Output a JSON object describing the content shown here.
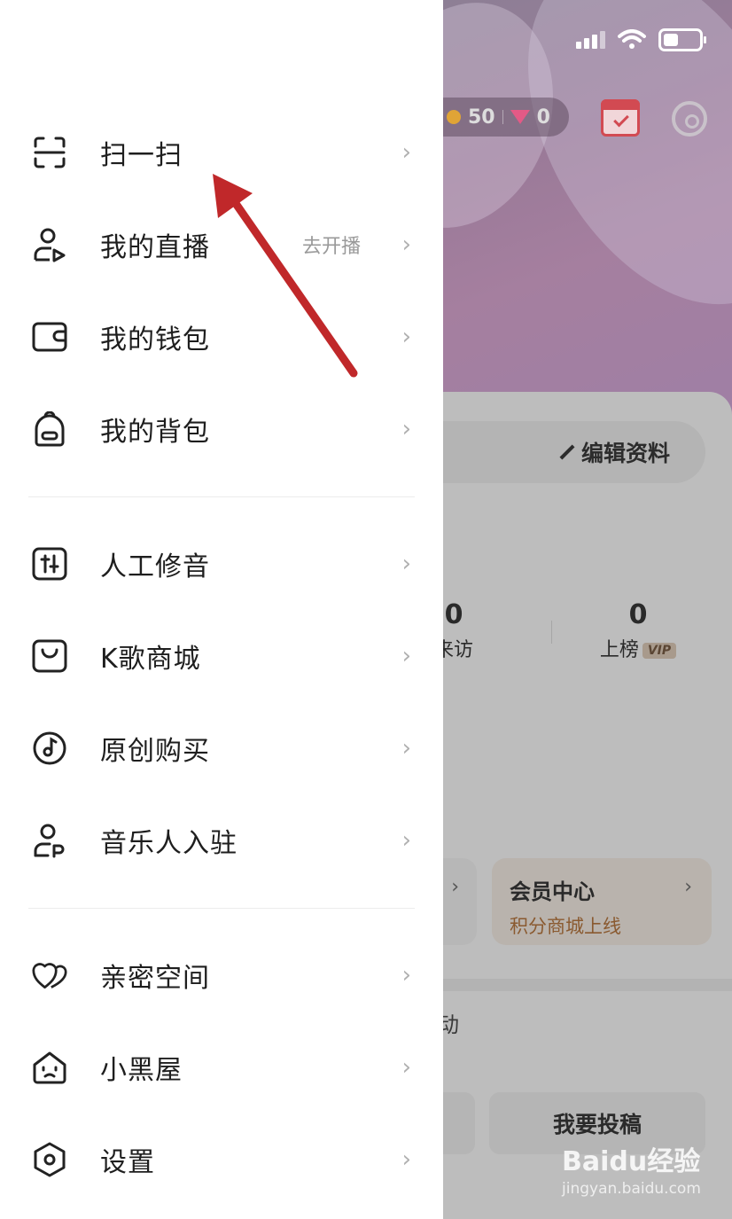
{
  "menu": {
    "items": [
      {
        "label": "扫一扫",
        "sub": "",
        "icon": "scan-icon"
      },
      {
        "label": "我的直播",
        "sub": "去开播",
        "icon": "live-user-icon"
      },
      {
        "label": "我的钱包",
        "sub": "",
        "icon": "wallet-icon"
      },
      {
        "label": "我的背包",
        "sub": "",
        "icon": "backpack-icon"
      },
      {
        "label": "人工修音",
        "sub": "",
        "icon": "sliders-icon"
      },
      {
        "label": "K歌商城",
        "sub": "",
        "icon": "shop-bag-icon"
      },
      {
        "label": "原创购买",
        "sub": "",
        "icon": "music-disc-icon"
      },
      {
        "label": "音乐人入驻",
        "sub": "",
        "icon": "musician-icon"
      },
      {
        "label": "亲密空间",
        "sub": "",
        "icon": "hearts-icon"
      },
      {
        "label": "小黑屋",
        "sub": "",
        "icon": "house-face-icon"
      },
      {
        "label": "设置",
        "sub": "",
        "icon": "settings-hex-icon"
      }
    ],
    "chevron": "›"
  },
  "background": {
    "coins": "50",
    "gems": "0",
    "edit_profile": "编辑资料",
    "visits_value": "0",
    "visits_label": "来访",
    "rank_value": "0",
    "rank_label": "上榜",
    "vip_badge": "VIP",
    "vip_center_title": "会员中心",
    "vip_center_sub": "积分商城上线",
    "partial_text": "动",
    "submit_label": "我要投稿",
    "watermark_main": "Baidu经验",
    "watermark_sub": "jingyan.baidu.com"
  },
  "colors": {
    "annotation_arrow": "#c0282a",
    "menu_text": "#1e1e1e",
    "chevron": "#b0b0b0"
  }
}
